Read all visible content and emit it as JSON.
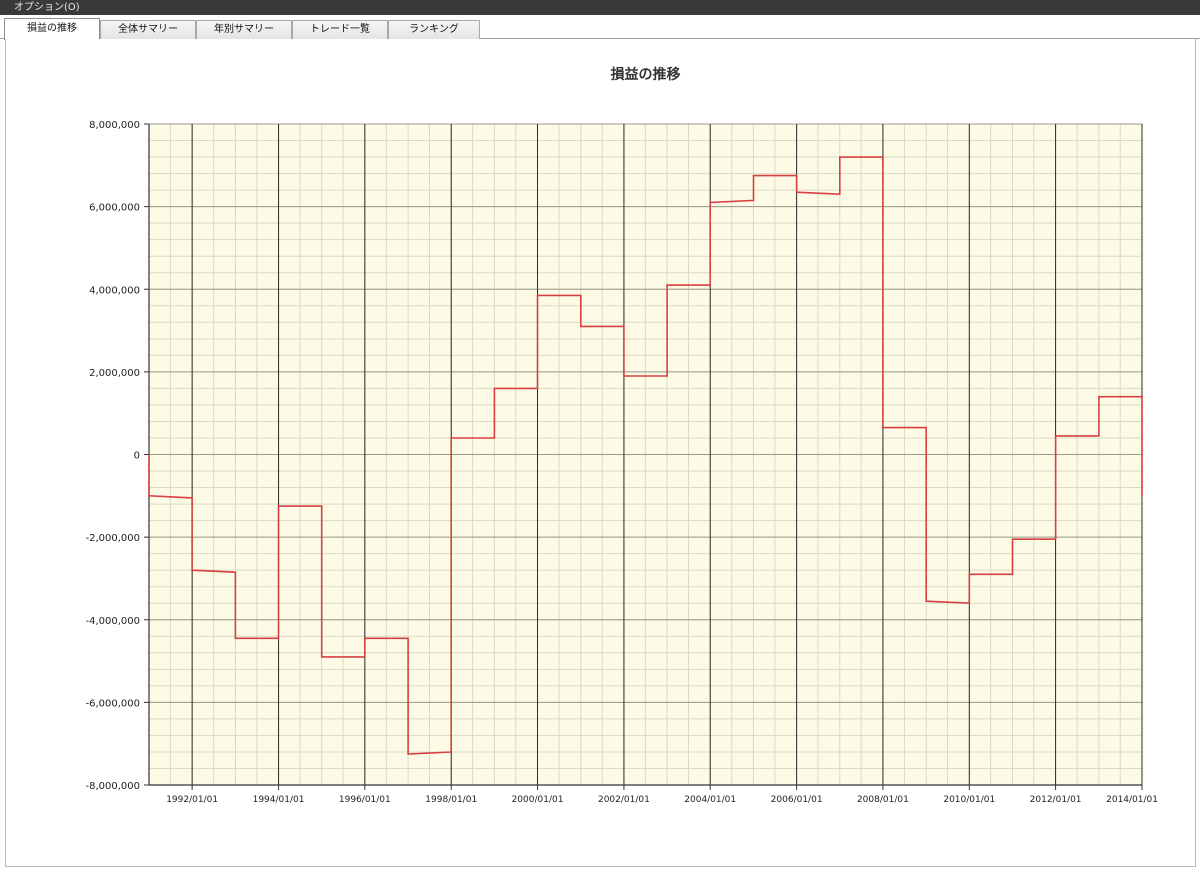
{
  "window": {
    "menu_label": "オプション(O)"
  },
  "tabs": [
    {
      "label": "損益の推移",
      "active": true
    },
    {
      "label": "全体サマリー",
      "active": false
    },
    {
      "label": "年別サマリー",
      "active": false
    },
    {
      "label": "トレード一覧",
      "active": false
    },
    {
      "label": "ランキング",
      "active": false
    }
  ],
  "colors": {
    "plot_background": "#fdfbe6",
    "series_line": "#d84040",
    "major_grid": "#2a2a2a",
    "minor_grid": "#d9d9c8"
  },
  "chart_data": {
    "type": "line",
    "title": "損益の推移",
    "xlabel": "",
    "ylabel": "",
    "ylim": [
      -8000000,
      8000000
    ],
    "xlim": [
      "1991-01-01",
      "2014-01-01"
    ],
    "yticks": [
      {
        "value": 8000000,
        "label": "8,000,000"
      },
      {
        "value": 6000000,
        "label": "6,000,000"
      },
      {
        "value": 4000000,
        "label": "4,000,000"
      },
      {
        "value": 2000000,
        "label": "2,000,000"
      },
      {
        "value": 0,
        "label": "0"
      },
      {
        "value": -2000000,
        "label": "-2,000,000"
      },
      {
        "value": -4000000,
        "label": "-4,000,000"
      },
      {
        "value": -6000000,
        "label": "-6,000,000"
      },
      {
        "value": -8000000,
        "label": "-8,000,000"
      }
    ],
    "xticks": [
      {
        "value": "1992-01-01",
        "label": "1992/01/01"
      },
      {
        "value": "1994-01-01",
        "label": "1994/01/01"
      },
      {
        "value": "1996-01-01",
        "label": "1996/01/01"
      },
      {
        "value": "1998-01-01",
        "label": "1998/01/01"
      },
      {
        "value": "2000-01-01",
        "label": "2000/01/01"
      },
      {
        "value": "2002-01-01",
        "label": "2002/01/01"
      },
      {
        "value": "2004-01-01",
        "label": "2004/01/01"
      },
      {
        "value": "2006-01-01",
        "label": "2006/01/01"
      },
      {
        "value": "2008-01-01",
        "label": "2008/01/01"
      },
      {
        "value": "2010-01-01",
        "label": "2010/01/01"
      },
      {
        "value": "2012-01-01",
        "label": "2012/01/01"
      },
      {
        "value": "2014-01-01",
        "label": "2014/01/01"
      }
    ],
    "grid": true,
    "legend": "none",
    "series": [
      {
        "style": "step",
        "points": [
          [
            "1991-01-01",
            0
          ],
          [
            "1991-01-01",
            -1000000
          ],
          [
            "1992-01-01",
            -1050000
          ],
          [
            "1992-01-01",
            -2800000
          ],
          [
            "1993-01-01",
            -2850000
          ],
          [
            "1993-01-01",
            -4450000
          ],
          [
            "1994-01-01",
            -4450000
          ],
          [
            "1994-01-01",
            -1250000
          ],
          [
            "1995-01-01",
            -1250000
          ],
          [
            "1995-01-01",
            -4900000
          ],
          [
            "1996-01-01",
            -4900000
          ],
          [
            "1996-01-01",
            -4450000
          ],
          [
            "1997-01-01",
            -4450000
          ],
          [
            "1997-01-01",
            -7250000
          ],
          [
            "1998-01-01",
            -7200000
          ],
          [
            "1998-01-01",
            400000
          ],
          [
            "1999-01-01",
            400000
          ],
          [
            "1999-01-01",
            1600000
          ],
          [
            "2000-01-01",
            1600000
          ],
          [
            "2000-01-01",
            3850000
          ],
          [
            "2001-01-01",
            3850000
          ],
          [
            "2001-01-01",
            3100000
          ],
          [
            "2002-01-01",
            3100000
          ],
          [
            "2002-01-01",
            1900000
          ],
          [
            "2003-01-01",
            1900000
          ],
          [
            "2003-01-01",
            4100000
          ],
          [
            "2004-01-01",
            4100000
          ],
          [
            "2004-01-01",
            6100000
          ],
          [
            "2005-01-01",
            6150000
          ],
          [
            "2005-01-01",
            6750000
          ],
          [
            "2006-01-01",
            6750000
          ],
          [
            "2006-01-01",
            6350000
          ],
          [
            "2007-01-01",
            6300000
          ],
          [
            "2007-01-01",
            7200000
          ],
          [
            "2008-01-01",
            7200000
          ],
          [
            "2008-01-01",
            650000
          ],
          [
            "2009-01-01",
            650000
          ],
          [
            "2009-01-01",
            -3550000
          ],
          [
            "2010-01-01",
            -3600000
          ],
          [
            "2010-01-01",
            -2900000
          ],
          [
            "2011-01-01",
            -2900000
          ],
          [
            "2011-01-01",
            -2050000
          ],
          [
            "2012-01-01",
            -2050000
          ],
          [
            "2012-01-01",
            450000
          ],
          [
            "2013-01-01",
            450000
          ],
          [
            "2013-01-01",
            1400000
          ],
          [
            "2014-01-01",
            1400000
          ],
          [
            "2014-01-01",
            -1000000
          ]
        ]
      }
    ]
  }
}
